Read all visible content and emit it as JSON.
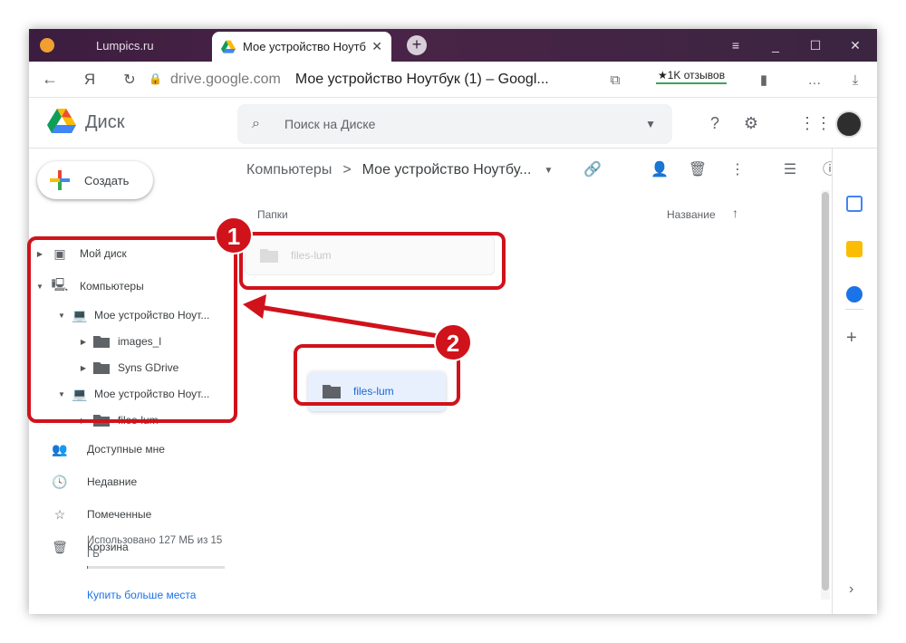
{
  "browser": {
    "tabs": [
      {
        "label": "Lumpics.ru",
        "active": false
      },
      {
        "label": "Мое устройство Ноутб",
        "active": true
      }
    ],
    "new_tab_icon": "plus-icon",
    "window_controls": [
      "≡",
      "_",
      "☐",
      "✕"
    ],
    "address": {
      "domain": "drive.google.com",
      "page_title": "Мое устройство Ноутбук (1) – Googl...",
      "reviews_label": "★1K отзывов"
    }
  },
  "drive": {
    "app_name": "Диск",
    "search_placeholder": "Поиск на Диске",
    "create_label": "Создать",
    "nav": [
      {
        "label": "Мой диск"
      },
      {
        "label": "Компьютеры"
      },
      {
        "label": "Мое устройство Ноут..."
      },
      {
        "label": "images_l"
      },
      {
        "label": "Syns GDrive"
      },
      {
        "label": "Мое устройство Ноут..."
      },
      {
        "label": "files-lum"
      },
      {
        "label": "Доступные мне"
      },
      {
        "label": "Недавние"
      },
      {
        "label": "Помеченные"
      },
      {
        "label": "Корзина"
      }
    ],
    "storage_text": "Использовано 127 МБ из 15 ГБ",
    "storage_fraction": 0.008,
    "buy_storage": "Купить больше места",
    "breadcrumb": {
      "root": "Компьютеры",
      "separator": ">",
      "current": "Мое устройство Ноутбу..."
    },
    "section_title": "Папки",
    "sort_label": "Название",
    "folders": [
      {
        "name": "files-lum",
        "state": "ghost"
      },
      {
        "name": "files-lum",
        "state": "dragging"
      }
    ]
  },
  "annotations": {
    "marker_1": "1",
    "marker_2": "2",
    "color": "#d0121b"
  },
  "colors": {
    "accent": "#1a73e8",
    "tabbar": "#3c1d3f",
    "annotation": "#d0121b"
  }
}
